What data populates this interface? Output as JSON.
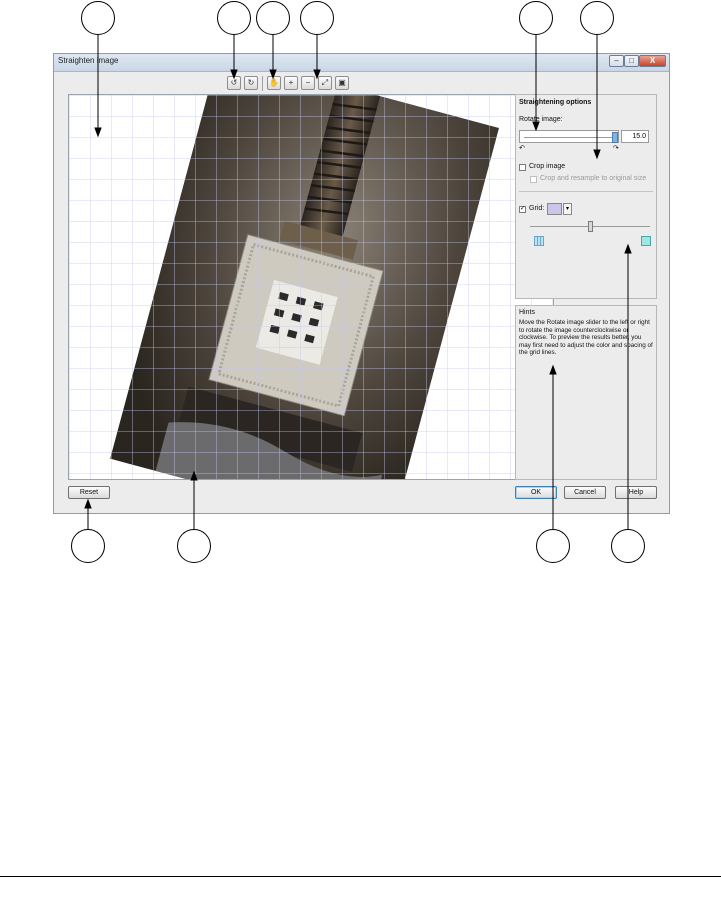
{
  "dialog": {
    "title": "Straighten image",
    "window_buttons": {
      "minimize": "–",
      "maximize": "□",
      "close": "X"
    }
  },
  "toolbar": {
    "icons": [
      "rotate-left-icon",
      "rotate-right-icon",
      "pan-icon",
      "zoom-in-icon",
      "zoom-out-icon",
      "fit-icon",
      "actual-size-icon"
    ]
  },
  "options": {
    "heading": "Straightening options",
    "rotate_label": "Rotate image:",
    "rotate_value": "15.0",
    "crop_label": "Crop image",
    "crop_resample_label": "Crop and resample to original size",
    "grid_label": "Grid:",
    "grid_color": "#c9c6ea"
  },
  "hints": {
    "title": "Hints",
    "text": "Move the Rotate image slider to the left or right to rotate the image counterclockwise or clockwise. To preview the results better, you may first need to adjust the color and spacing of the grid lines."
  },
  "buttons": {
    "reset": "Reset",
    "ok": "OK",
    "cancel": "Cancel",
    "help": "Help"
  },
  "colors": {
    "grid_line": "#c4c8f0",
    "photo_dark": "#4a4138",
    "chip_light": "#d9d6cc"
  }
}
